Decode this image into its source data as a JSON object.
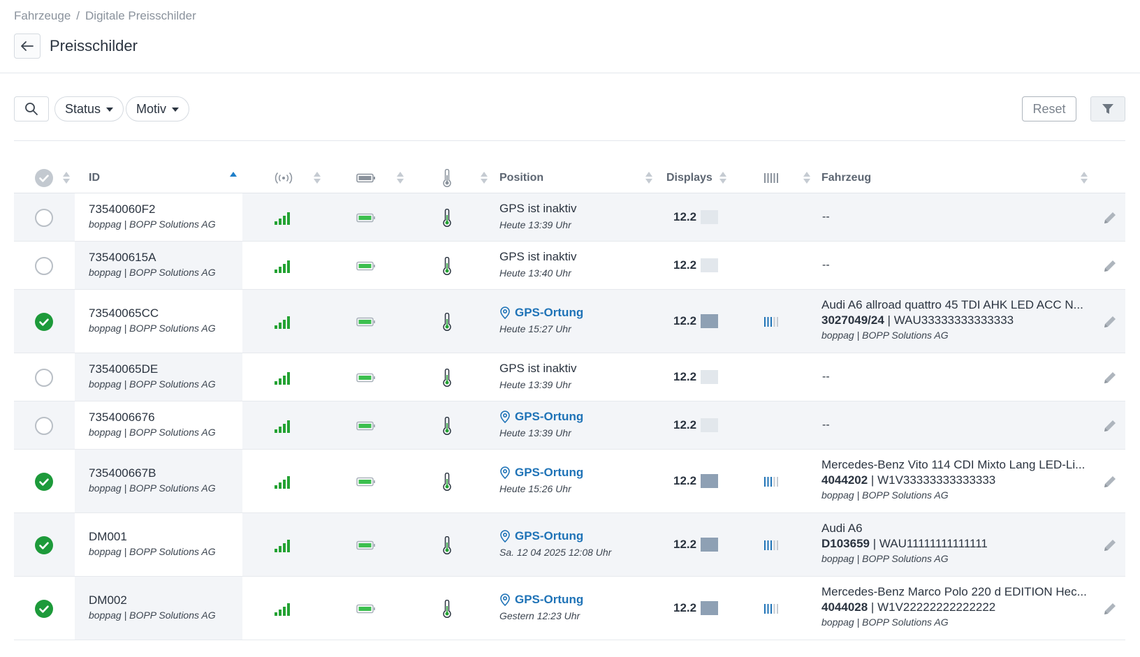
{
  "breadcrumb": {
    "items": [
      "Fahrzeuge",
      "Digitale Preisschilder"
    ],
    "separator": "/"
  },
  "page": {
    "title": "Preisschilder"
  },
  "toolbar": {
    "status_label": "Status",
    "motiv_label": "Motiv",
    "reset_label": "Reset"
  },
  "columns": {
    "id": "ID",
    "signal": "signal-icon",
    "battery": "battery-icon",
    "temperature": "thermometer-icon",
    "position": "Position",
    "displays": "Displays",
    "barcode": "barcode-icon",
    "vehicle": "Fahrzeug",
    "sorted_by": "ID"
  },
  "colors": {
    "accent": "#1f73b7",
    "success": "#1d9a3a",
    "signal": "#24a233",
    "battery": "#3cbf4f",
    "display_active": "#8ea0b4",
    "display_inactive": "#e2e7ec"
  },
  "rows": [
    {
      "checked": false,
      "id": "73540060F2",
      "owner": "boppag | BOPP Solutions AG",
      "gps": false,
      "position": "GPS ist inaktiv",
      "time": "Heute 13:39 Uhr",
      "display": "12.2",
      "display_active": false,
      "vehicle": null,
      "vehicle_placeholder": "--"
    },
    {
      "checked": false,
      "id": "735400615A",
      "owner": "boppag | BOPP Solutions AG",
      "gps": false,
      "position": "GPS ist inaktiv",
      "time": "Heute 13:40 Uhr",
      "display": "12.2",
      "display_active": false,
      "vehicle": null,
      "vehicle_placeholder": "--"
    },
    {
      "checked": true,
      "id": "73540065CC",
      "owner": "boppag | BOPP Solutions AG",
      "gps": true,
      "position": "GPS-Ortung",
      "time": "Heute 15:27 Uhr",
      "display": "12.2",
      "display_active": true,
      "vehicle": {
        "name": "Audi A6 allroad quattro 45 TDI AHK LED ACC N...",
        "number": "3027049/24",
        "vin": "WAU33333333333333",
        "owner": "boppag | BOPP Solutions AG"
      }
    },
    {
      "checked": false,
      "id": "73540065DE",
      "owner": "boppag | BOPP Solutions AG",
      "gps": false,
      "position": "GPS ist inaktiv",
      "time": "Heute 13:39 Uhr",
      "display": "12.2",
      "display_active": false,
      "vehicle": null,
      "vehicle_placeholder": "--"
    },
    {
      "checked": false,
      "id": "7354006676",
      "owner": "boppag | BOPP Solutions AG",
      "gps": true,
      "position": "GPS-Ortung",
      "time": "Heute 13:39 Uhr",
      "display": "12.2",
      "display_active": false,
      "vehicle": null,
      "vehicle_placeholder": "--"
    },
    {
      "checked": true,
      "id": "735400667B",
      "owner": "boppag | BOPP Solutions AG",
      "gps": true,
      "position": "GPS-Ortung",
      "time": "Heute 15:26 Uhr",
      "display": "12.2",
      "display_active": true,
      "vehicle": {
        "name": "Mercedes-Benz Vito 114 CDI Mixto Lang LED-Li...",
        "number": "4044202",
        "vin": "W1V33333333333333",
        "owner": "boppag | BOPP Solutions AG"
      }
    },
    {
      "checked": true,
      "id": "DM001",
      "owner": "boppag | BOPP Solutions AG",
      "gps": true,
      "position": "GPS-Ortung",
      "time": "Sa. 12 04 2025 12:08 Uhr",
      "display": "12.2",
      "display_active": true,
      "vehicle": {
        "name": "Audi A6",
        "number": "D103659",
        "vin": "WAU11111111111111",
        "owner": "boppag | BOPP Solutions AG"
      }
    },
    {
      "checked": true,
      "id": "DM002",
      "owner": "boppag | BOPP Solutions AG",
      "gps": true,
      "position": "GPS-Ortung",
      "time": "Gestern 12:23 Uhr",
      "display": "12.2",
      "display_active": true,
      "vehicle": {
        "name": "Mercedes-Benz Marco Polo 220 d EDITION Hec...",
        "number": "4044028",
        "vin": "W1V22222222222222",
        "owner": "boppag | BOPP Solutions AG"
      }
    }
  ]
}
